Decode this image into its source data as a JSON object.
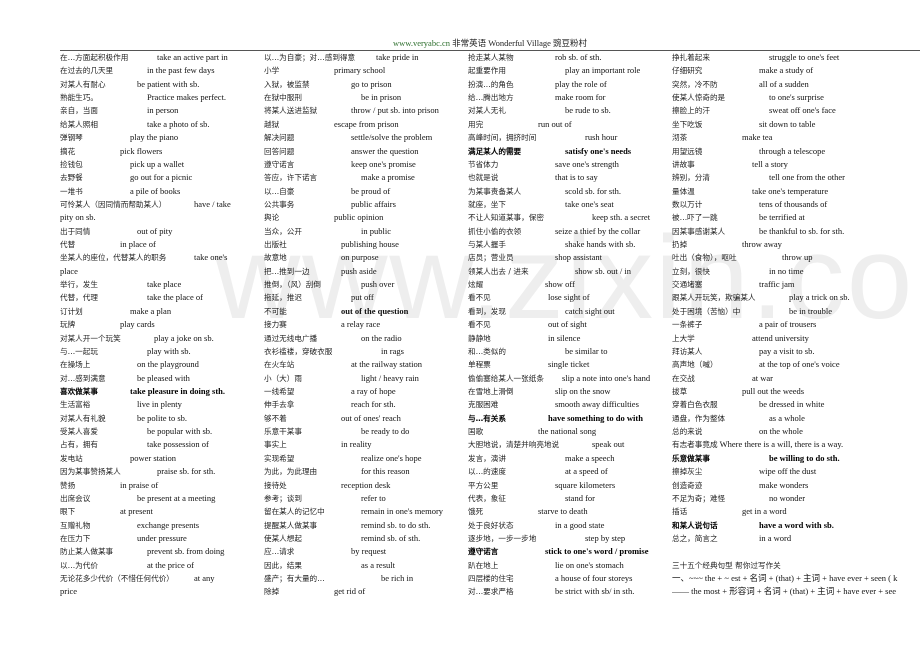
{
  "header": {
    "url": "www.veryabc.cn",
    "site_name": "非常英语",
    "village": "Wonderful Village",
    "village_cn": "豌豆粉村"
  },
  "watermark": "www.zixin.com.cn",
  "columns": [
    {
      "rows": [
        {
          "zh": "在…方面起积极作用",
          "en": "take an active part in"
        },
        {
          "zh": "在过去的几天里",
          "en": "in the past few days"
        },
        {
          "zh": "对某人有耐心",
          "en": "be patient with sb."
        },
        {
          "zh": "熟能生巧。",
          "en": "Practice makes perfect."
        },
        {
          "zh": "亲自，当面",
          "en": "in person"
        },
        {
          "zh": "给某人照相",
          "en": "take a photo of sb."
        },
        {
          "zh": "弹钢琴",
          "en": "play the piano"
        },
        {
          "zh": "摘花",
          "en": "pick flowers"
        },
        {
          "zh": "捡钱包",
          "en": "pick up a wallet"
        },
        {
          "zh": "去野餐",
          "en": "go out for a picnic"
        },
        {
          "zh": "一堆书",
          "en": "a pile of books"
        },
        {
          "zh": "可怜某人（因同情而帮助某人）",
          "en": "have / take",
          "cont": "pity on sb."
        },
        {
          "zh": "出于同情",
          "en": "out of pity"
        },
        {
          "zh": "代替",
          "en": "in place of"
        },
        {
          "zh": "坐某人的座位，代替某人的职务",
          "en": "take one's",
          "cont": "place"
        },
        {
          "zh": "举行，发生",
          "en": "take place"
        },
        {
          "zh": "代替，代理",
          "en": "take the place of"
        },
        {
          "zh": "订计划",
          "en": "make a plan"
        },
        {
          "zh": "玩牌",
          "en": "play cards"
        },
        {
          "zh": "对某人开一个玩笑",
          "en": "play a joke on sb."
        },
        {
          "zh": "与…一起玩",
          "en": "play with sb."
        },
        {
          "zh": "在操场上",
          "en": "on the playground"
        },
        {
          "zh": "对…感到满意",
          "en": "be pleased with"
        },
        {
          "zh": "喜欢做某事",
          "en": "take pleasure in doing sth.",
          "bold": true
        },
        {
          "zh": "生活富裕",
          "en": "live in plenty"
        },
        {
          "zh": "对某人有礼貌",
          "en": "be polite to sb."
        },
        {
          "zh": "受某人喜爱",
          "en": "be popular with sb."
        },
        {
          "zh": "占有，拥有",
          "en": "take possession of"
        },
        {
          "zh": "发电站",
          "en": "power station"
        },
        {
          "zh": "因为某事赞扬某人",
          "en": "praise sb. for sth."
        },
        {
          "zh": "赞扬",
          "en": "in praise of"
        },
        {
          "zh": "出席会议",
          "en": "be present at a meeting"
        },
        {
          "zh": "眼下",
          "en": "at present"
        },
        {
          "zh": "互赠礼物",
          "en": "exchange presents"
        },
        {
          "zh": "在压力下",
          "en": "under pressure"
        },
        {
          "zh": "防止某人做某事",
          "en": "prevent sb. from doing"
        },
        {
          "zh": "以…为代价",
          "en": "at the price of"
        },
        {
          "zh": "无论花多少代价（不惜任何代价）",
          "en": "at any",
          "cont": "price"
        }
      ]
    },
    {
      "rows": [
        {
          "zh": "以…为自豪；对…感到得意",
          "en": "take pride in"
        },
        {
          "zh": "小学",
          "en": "primary school"
        },
        {
          "zh": "入狱，被监禁",
          "en": "go to prison"
        },
        {
          "zh": "在狱中服刑",
          "en": "be in prison"
        },
        {
          "zh": "将某人送进监狱",
          "en": "throw / put sb. into prison"
        },
        {
          "zh": "越狱",
          "en": "escape from prison"
        },
        {
          "zh": "解决问题",
          "en": "settle/solve the problem"
        },
        {
          "zh": "回答问题",
          "en": "answer the question"
        },
        {
          "zh": "遵守诺言",
          "en": "keep one's promise"
        },
        {
          "zh": "答应，许下诺言",
          "en": "make a promise"
        },
        {
          "zh": "以…自豪",
          "en": "be proud of"
        },
        {
          "zh": "公共事务",
          "en": "public affairs"
        },
        {
          "zh": "舆论",
          "en": "public opinion"
        },
        {
          "zh": "当众，公开",
          "en": "in public"
        },
        {
          "zh": "出版社",
          "en": "publishing house"
        },
        {
          "zh": "故意地",
          "en": "on purpose"
        },
        {
          "zh": "把…推到一边",
          "en": "push aside"
        },
        {
          "zh": "推倒，（风）刮倒",
          "en": "push over"
        },
        {
          "zh": "拖延，推迟",
          "en": "put off"
        },
        {
          "zh": "不可能",
          "en": "out of the question",
          "bold_en": true
        },
        {
          "zh": "接力赛",
          "en": "a relay race"
        },
        {
          "zh": "通过无线电广播",
          "en": "on the radio"
        },
        {
          "zh": "衣衫褴褛，穿破衣服",
          "en": "in rags"
        },
        {
          "zh": "在火车站",
          "en": "at the railway station"
        },
        {
          "zh": "小（大）雨",
          "en": "light / heavy rain"
        },
        {
          "zh": "一线希望",
          "en": "a ray of hope"
        },
        {
          "zh": "伸手去拿",
          "en": "reach for sth."
        },
        {
          "zh": "够不着",
          "en": "out of ones' reach"
        },
        {
          "zh": "乐意干某事",
          "en": "be ready to do"
        },
        {
          "zh": "事实上",
          "en": "in reality"
        },
        {
          "zh": "实现希望",
          "en": "realize one's hope"
        },
        {
          "zh": "为此，为此理由",
          "en": "for this reason"
        },
        {
          "zh": "接待处",
          "en": "reception desk"
        },
        {
          "zh": "参考；谈到",
          "en": "refer to"
        },
        {
          "zh": "留在某人的记忆中",
          "en": "remain in one's memory"
        },
        {
          "zh": "提醒某人做某事",
          "en": "remind sb. to do sth."
        },
        {
          "zh": "使某人想起",
          "en": "remind sb. of sth."
        },
        {
          "zh": "应…请求",
          "en": "by request"
        },
        {
          "zh": "因此，结果",
          "en": "as a result"
        },
        {
          "zh": "盛产；有大量的…",
          "en": "be rich in"
        },
        {
          "zh": "除掉",
          "en": "get rid of"
        }
      ]
    },
    {
      "rows": [
        {
          "zh": "抢走某人某物",
          "en": "rob sb. of sth."
        },
        {
          "zh": "起重要作用",
          "en": "play an important role"
        },
        {
          "zh": "扮演…的角色",
          "en": "play the role of"
        },
        {
          "zh": "给…腾出地方",
          "en": "make room for"
        },
        {
          "zh": "对某人无礼",
          "en": "be rude to sb."
        },
        {
          "zh": "用完",
          "en": "run out of"
        },
        {
          "zh": "高峰时间，拥挤时间",
          "en": "rush hour"
        },
        {
          "zh": "满足某人的需要",
          "en": "satisfy one's needs",
          "bold": true
        },
        {
          "zh": "节省体力",
          "en": "save one's strength"
        },
        {
          "zh": "也就是说",
          "en": "that is to say"
        },
        {
          "zh": "为某事责备某人",
          "en": "scold sb. for sth."
        },
        {
          "zh": "就座，坐下",
          "en": "take one's seat"
        },
        {
          "zh": "不让人知道某事，保密",
          "en": "keep sth. a secret"
        },
        {
          "zh": "抓住小偷的衣领",
          "en": "seize a thief by the collar"
        },
        {
          "zh": "与某人握手",
          "en": "shake hands with sb."
        },
        {
          "zh": "店员；营业员",
          "en": "shop assistant"
        },
        {
          "zh": "领某人出去 / 进来",
          "en": "show sb. out / in"
        },
        {
          "zh": "炫耀",
          "en": "show off"
        },
        {
          "zh": "看不见",
          "en": "lose sight of"
        },
        {
          "zh": "看到，发现",
          "en": "catch sight out"
        },
        {
          "zh": "看不见",
          "en": "out of sight"
        },
        {
          "zh": "静静地",
          "en": "in silence"
        },
        {
          "zh": "和…类似的",
          "en": "be similar to"
        },
        {
          "zh": "单程票",
          "en": "single ticket"
        },
        {
          "zh": "偷偷塞给某人一张纸条",
          "en": "slip a note into one's hand"
        },
        {
          "zh": "在雪地上滑倒",
          "en": "slip on the snow"
        },
        {
          "zh": "克服困难",
          "en": "smooth away difficulties"
        },
        {
          "zh": "与…有关系",
          "en": "have something to do with",
          "bold": true
        },
        {
          "zh": "国歌",
          "en": "the national song"
        },
        {
          "zh": "大胆地说，清楚并响亮地说",
          "en": "speak out"
        },
        {
          "zh": "发言，演讲",
          "en": "make a speech"
        },
        {
          "zh": "以…的速度",
          "en": "at a speed of"
        },
        {
          "zh": "平方公里",
          "en": "square kilometers"
        },
        {
          "zh": "代表，象征",
          "en": "stand for"
        },
        {
          "zh": "饿死",
          "en": "starve to death"
        },
        {
          "zh": "处于良好状态",
          "en": "in a good state"
        },
        {
          "zh": "逐步地，一步一步地",
          "en": "step by step"
        },
        {
          "zh": "遵守诺言",
          "en": "stick to one's word / promise",
          "bold": true
        },
        {
          "zh": "趴在地上",
          "en": "lie on one's stomach"
        },
        {
          "zh": "四层楼的住宅",
          "en": "a house of four storeys"
        },
        {
          "zh": "对…要求严格",
          "en": "be strict with sb/ in sth."
        }
      ]
    },
    {
      "rows": [
        {
          "zh": "挣扎着起来",
          "en": "struggle to one's feet"
        },
        {
          "zh": "仔细研究",
          "en": "make a study of"
        },
        {
          "zh": "突然，冷不防",
          "en": "all of a sudden"
        },
        {
          "zh": "使某人惊奇的是",
          "en": "to one's surprise"
        },
        {
          "zh": "擦脸上的汗",
          "en": "sweat off one's face"
        },
        {
          "zh": "坐下吃饭",
          "en": "sit down to table"
        },
        {
          "zh": "沏茶",
          "en": "make tea"
        },
        {
          "zh": "用望远镜",
          "en": "through a telescope"
        },
        {
          "zh": "讲故事",
          "en": "tell a story"
        },
        {
          "zh": "辨别，分清",
          "en": "tell one from the other"
        },
        {
          "zh": "量体温",
          "en": "take one's temperature"
        },
        {
          "zh": "数以万计",
          "en": "tens of thousands of"
        },
        {
          "zh": "被…吓了一跳",
          "en": "be terrified at"
        },
        {
          "zh": "因某事感谢某人",
          "en": "be thankful to sb. for sth."
        },
        {
          "zh": "扔掉",
          "en": "throw away"
        },
        {
          "zh": "吐出（食物），呕吐",
          "en": "throw up"
        },
        {
          "zh": "立刻，很快",
          "en": "in no time"
        },
        {
          "zh": "交通堵塞",
          "en": "traffic jam"
        },
        {
          "zh": "跟某人开玩笑，欺骗某人",
          "en": "play a trick on sb."
        },
        {
          "zh": "处于困境（苦恼）中",
          "en": "be in trouble"
        },
        {
          "zh": "一条裤子",
          "en": "a pair of trousers"
        },
        {
          "zh": "上大学",
          "en": "attend university"
        },
        {
          "zh": "拜访某人",
          "en": "pay a visit to sb."
        },
        {
          "zh": "高声地（喊）",
          "en": "at the top of one's voice"
        },
        {
          "zh": "在交战",
          "en": "at war"
        },
        {
          "zh": "拔草",
          "en": "pull out the weeds"
        },
        {
          "zh": "穿着白色衣服",
          "en": "be dressed in white"
        },
        {
          "zh": "通盘，作为整体",
          "en": "as a whole"
        },
        {
          "zh": "总的来说",
          "en": "on the whole"
        },
        {
          "zh": "有志者事竟成",
          "en": "Where there is a will, there is a way.",
          "inline": true
        },
        {
          "zh": "乐意做某事",
          "en": "be willing to do sth.",
          "bold": true
        },
        {
          "zh": "擦掉灰尘",
          "en": "wipe off the dust"
        },
        {
          "zh": "创造奇迹",
          "en": "make wonders"
        },
        {
          "zh": "不足为奇；难怪",
          "en": "no wonder"
        },
        {
          "zh": "插话",
          "en": "get in a word"
        },
        {
          "zh": "和某人说句话",
          "en": "have a word with sb.",
          "bold": true
        },
        {
          "zh": "总之，简言之",
          "en": "in a word"
        }
      ],
      "section_title": "三十五个经典句型  帮你过写作关",
      "patterns": [
        "一、~~~ the + ~ est + 名词 + (that) + 主词 + have ever + seen ( k",
        "—— the most + 形容词 + 名词 + (that) + 主词 + have ever + see"
      ]
    }
  ],
  "en_offsets": {
    "c1": [
      97,
      87,
      77,
      87,
      87,
      87,
      70,
      60,
      70,
      70,
      70,
      134,
      77,
      60,
      134,
      87,
      87,
      70,
      60,
      94,
      87,
      77,
      77,
      70,
      77,
      77,
      87,
      87,
      70,
      97,
      60,
      77,
      60,
      77,
      77,
      87,
      87,
      134
    ],
    "c2": [
      112,
      70,
      87,
      97,
      87,
      70,
      87,
      87,
      87,
      97,
      87,
      87,
      70,
      97,
      77,
      77,
      77,
      97,
      87,
      77,
      77,
      97,
      117,
      87,
      97,
      87,
      87,
      77,
      97,
      77,
      97,
      97,
      77,
      97,
      97,
      97,
      97,
      87,
      97,
      117,
      70
    ],
    "c3": [
      87,
      97,
      87,
      87,
      97,
      70,
      117,
      97,
      87,
      87,
      97,
      97,
      124,
      87,
      97,
      87,
      107,
      77,
      80,
      97,
      80,
      80,
      97,
      80,
      0,
      87,
      87,
      80,
      70,
      124,
      97,
      97,
      87,
      97,
      70,
      87,
      117,
      77,
      87,
      87,
      87
    ],
    "c4": [
      97,
      87,
      87,
      97,
      97,
      87,
      70,
      87,
      80,
      97,
      80,
      87,
      87,
      87,
      70,
      110,
      97,
      87,
      117,
      117,
      87,
      80,
      87,
      87,
      80,
      70,
      87,
      97,
      87,
      0,
      97,
      87,
      87,
      97,
      70,
      87,
      87
    ]
  }
}
